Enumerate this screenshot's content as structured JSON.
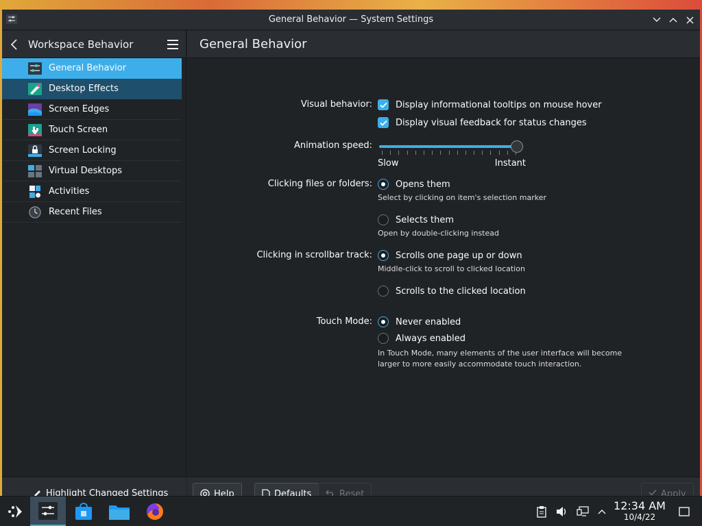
{
  "window": {
    "title": "General Behavior — System Settings"
  },
  "sidebar": {
    "header": "Workspace Behavior",
    "items": [
      {
        "label": "General Behavior",
        "icon": "general-behavior-icon",
        "state": "active"
      },
      {
        "label": "Desktop Effects",
        "icon": "desktop-effects-icon",
        "state": "hover"
      },
      {
        "label": "Screen Edges",
        "icon": "screen-edges-icon",
        "state": ""
      },
      {
        "label": "Touch Screen",
        "icon": "touch-screen-icon",
        "state": ""
      },
      {
        "label": "Screen Locking",
        "icon": "screen-locking-icon",
        "state": ""
      },
      {
        "label": "Virtual Desktops",
        "icon": "virtual-desktops-icon",
        "state": ""
      },
      {
        "label": "Activities",
        "icon": "activities-icon",
        "state": ""
      },
      {
        "label": "Recent Files",
        "icon": "recent-files-icon",
        "state": ""
      }
    ],
    "footer": "Highlight Changed Settings"
  },
  "main": {
    "title": "General Behavior",
    "visual_behavior": {
      "label": "Visual behavior:",
      "tooltips": "Display informational tooltips on mouse hover",
      "feedback": "Display visual feedback for status changes"
    },
    "animation": {
      "label": "Animation speed:",
      "min_label": "Slow",
      "max_label": "Instant",
      "value": 1.0
    },
    "clicking_files": {
      "label": "Clicking files or folders:",
      "opt1": "Opens them",
      "opt1_hint": "Select by clicking on item's selection marker",
      "opt2": "Selects them",
      "opt2_hint": "Open by double-clicking instead"
    },
    "scrollbar": {
      "label": "Clicking in scrollbar track:",
      "opt1": "Scrolls one page up or down",
      "opt1_hint": "Middle-click to scroll to clicked location",
      "opt2": "Scrolls to the clicked location"
    },
    "touch_mode": {
      "label": "Touch Mode:",
      "opt1": "Never enabled",
      "opt2": "Always enabled",
      "hint1": "In Touch Mode, many elements of the user interface will become",
      "hint2": "larger to more easily accommodate touch interaction."
    },
    "buttons": {
      "help": "Help",
      "defaults": "Defaults",
      "reset": "Reset",
      "apply": "Apply"
    }
  },
  "taskbar": {
    "time": "12:34 AM",
    "date": "10/4/22"
  },
  "colors": {
    "accent": "#3daee9",
    "background": "#202326",
    "panel": "#2a2e32"
  }
}
